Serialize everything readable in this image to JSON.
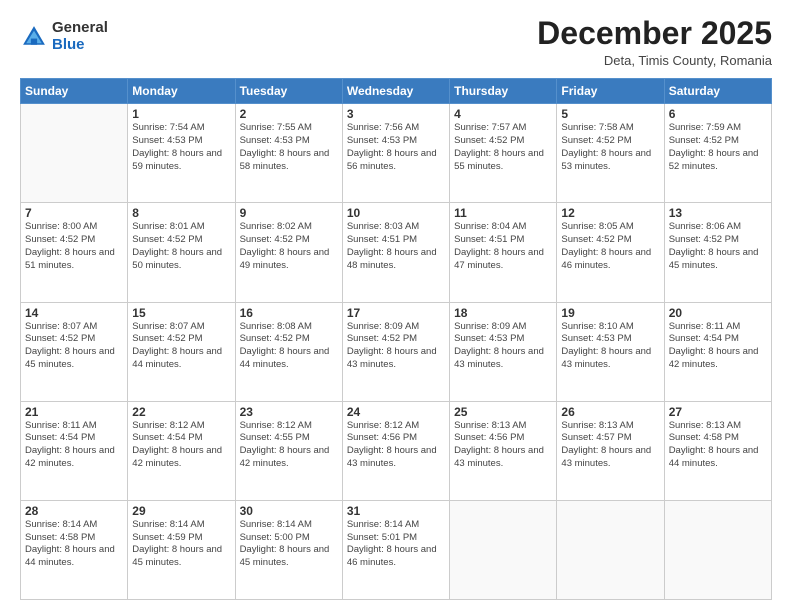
{
  "header": {
    "logo": {
      "general": "General",
      "blue": "Blue"
    },
    "title": "December 2025",
    "location": "Deta, Timis County, Romania"
  },
  "calendar": {
    "days_of_week": [
      "Sunday",
      "Monday",
      "Tuesday",
      "Wednesday",
      "Thursday",
      "Friday",
      "Saturday"
    ],
    "weeks": [
      [
        {
          "day": "",
          "sunrise": "",
          "sunset": "",
          "daylight": ""
        },
        {
          "day": "1",
          "sunrise": "7:54 AM",
          "sunset": "4:53 PM",
          "daylight": "8 hours and 59 minutes."
        },
        {
          "day": "2",
          "sunrise": "7:55 AM",
          "sunset": "4:53 PM",
          "daylight": "8 hours and 58 minutes."
        },
        {
          "day": "3",
          "sunrise": "7:56 AM",
          "sunset": "4:53 PM",
          "daylight": "8 hours and 56 minutes."
        },
        {
          "day": "4",
          "sunrise": "7:57 AM",
          "sunset": "4:52 PM",
          "daylight": "8 hours and 55 minutes."
        },
        {
          "day": "5",
          "sunrise": "7:58 AM",
          "sunset": "4:52 PM",
          "daylight": "8 hours and 53 minutes."
        },
        {
          "day": "6",
          "sunrise": "7:59 AM",
          "sunset": "4:52 PM",
          "daylight": "8 hours and 52 minutes."
        }
      ],
      [
        {
          "day": "7",
          "sunrise": "8:00 AM",
          "sunset": "4:52 PM",
          "daylight": "8 hours and 51 minutes."
        },
        {
          "day": "8",
          "sunrise": "8:01 AM",
          "sunset": "4:52 PM",
          "daylight": "8 hours and 50 minutes."
        },
        {
          "day": "9",
          "sunrise": "8:02 AM",
          "sunset": "4:52 PM",
          "daylight": "8 hours and 49 minutes."
        },
        {
          "day": "10",
          "sunrise": "8:03 AM",
          "sunset": "4:51 PM",
          "daylight": "8 hours and 48 minutes."
        },
        {
          "day": "11",
          "sunrise": "8:04 AM",
          "sunset": "4:51 PM",
          "daylight": "8 hours and 47 minutes."
        },
        {
          "day": "12",
          "sunrise": "8:05 AM",
          "sunset": "4:52 PM",
          "daylight": "8 hours and 46 minutes."
        },
        {
          "day": "13",
          "sunrise": "8:06 AM",
          "sunset": "4:52 PM",
          "daylight": "8 hours and 45 minutes."
        }
      ],
      [
        {
          "day": "14",
          "sunrise": "8:07 AM",
          "sunset": "4:52 PM",
          "daylight": "8 hours and 45 minutes."
        },
        {
          "day": "15",
          "sunrise": "8:07 AM",
          "sunset": "4:52 PM",
          "daylight": "8 hours and 44 minutes."
        },
        {
          "day": "16",
          "sunrise": "8:08 AM",
          "sunset": "4:52 PM",
          "daylight": "8 hours and 44 minutes."
        },
        {
          "day": "17",
          "sunrise": "8:09 AM",
          "sunset": "4:52 PM",
          "daylight": "8 hours and 43 minutes."
        },
        {
          "day": "18",
          "sunrise": "8:09 AM",
          "sunset": "4:53 PM",
          "daylight": "8 hours and 43 minutes."
        },
        {
          "day": "19",
          "sunrise": "8:10 AM",
          "sunset": "4:53 PM",
          "daylight": "8 hours and 43 minutes."
        },
        {
          "day": "20",
          "sunrise": "8:11 AM",
          "sunset": "4:54 PM",
          "daylight": "8 hours and 42 minutes."
        }
      ],
      [
        {
          "day": "21",
          "sunrise": "8:11 AM",
          "sunset": "4:54 PM",
          "daylight": "8 hours and 42 minutes."
        },
        {
          "day": "22",
          "sunrise": "8:12 AM",
          "sunset": "4:54 PM",
          "daylight": "8 hours and 42 minutes."
        },
        {
          "day": "23",
          "sunrise": "8:12 AM",
          "sunset": "4:55 PM",
          "daylight": "8 hours and 42 minutes."
        },
        {
          "day": "24",
          "sunrise": "8:12 AM",
          "sunset": "4:56 PM",
          "daylight": "8 hours and 43 minutes."
        },
        {
          "day": "25",
          "sunrise": "8:13 AM",
          "sunset": "4:56 PM",
          "daylight": "8 hours and 43 minutes."
        },
        {
          "day": "26",
          "sunrise": "8:13 AM",
          "sunset": "4:57 PM",
          "daylight": "8 hours and 43 minutes."
        },
        {
          "day": "27",
          "sunrise": "8:13 AM",
          "sunset": "4:58 PM",
          "daylight": "8 hours and 44 minutes."
        }
      ],
      [
        {
          "day": "28",
          "sunrise": "8:14 AM",
          "sunset": "4:58 PM",
          "daylight": "8 hours and 44 minutes."
        },
        {
          "day": "29",
          "sunrise": "8:14 AM",
          "sunset": "4:59 PM",
          "daylight": "8 hours and 45 minutes."
        },
        {
          "day": "30",
          "sunrise": "8:14 AM",
          "sunset": "5:00 PM",
          "daylight": "8 hours and 45 minutes."
        },
        {
          "day": "31",
          "sunrise": "8:14 AM",
          "sunset": "5:01 PM",
          "daylight": "8 hours and 46 minutes."
        },
        {
          "day": "",
          "sunrise": "",
          "sunset": "",
          "daylight": ""
        },
        {
          "day": "",
          "sunrise": "",
          "sunset": "",
          "daylight": ""
        },
        {
          "day": "",
          "sunrise": "",
          "sunset": "",
          "daylight": ""
        }
      ]
    ],
    "labels": {
      "sunrise": "Sunrise:",
      "sunset": "Sunset:",
      "daylight": "Daylight:"
    }
  }
}
